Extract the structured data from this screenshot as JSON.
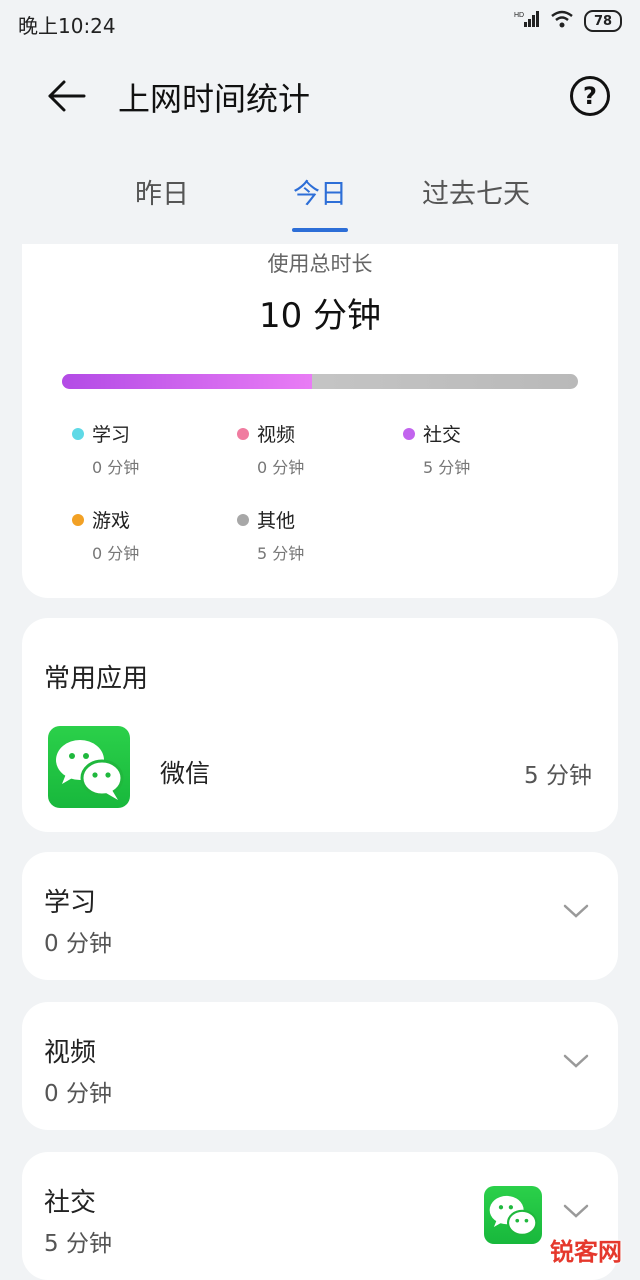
{
  "status": {
    "time": "晚上10:24",
    "battery": "78",
    "network": "HD"
  },
  "header": {
    "title": "上网时间统计"
  },
  "tabs": [
    {
      "label": "昨日",
      "active": false
    },
    {
      "label": "今日",
      "active": true
    },
    {
      "label": "过去七天",
      "active": false
    }
  ],
  "summary": {
    "label": "使用总时长",
    "total": "10 分钟",
    "usage_fraction_colored": 0.5,
    "legend": [
      {
        "name": "学习",
        "time": "0 分钟",
        "color": "#5fd9e6"
      },
      {
        "name": "视频",
        "time": "0 分钟",
        "color": "#f07ca0"
      },
      {
        "name": "社交",
        "time": "5 分钟",
        "color": "#c264ee"
      },
      {
        "name": "游戏",
        "time": "0 分钟",
        "color": "#f2a125"
      },
      {
        "name": "其他",
        "time": "5 分钟",
        "color": "#a7a7a7"
      }
    ]
  },
  "apps": {
    "title": "常用应用",
    "items": [
      {
        "name": "微信",
        "time": "5 分钟",
        "icon": "wechat-icon"
      }
    ]
  },
  "categories": [
    {
      "name": "学习",
      "time": "0 分钟"
    },
    {
      "name": "视频",
      "time": "0 分钟"
    },
    {
      "name": "社交",
      "time": "5 分钟"
    }
  ],
  "watermark": "锐客网",
  "colors": {
    "accent": "#2d6ed7",
    "wechat": "#1fc43f"
  }
}
